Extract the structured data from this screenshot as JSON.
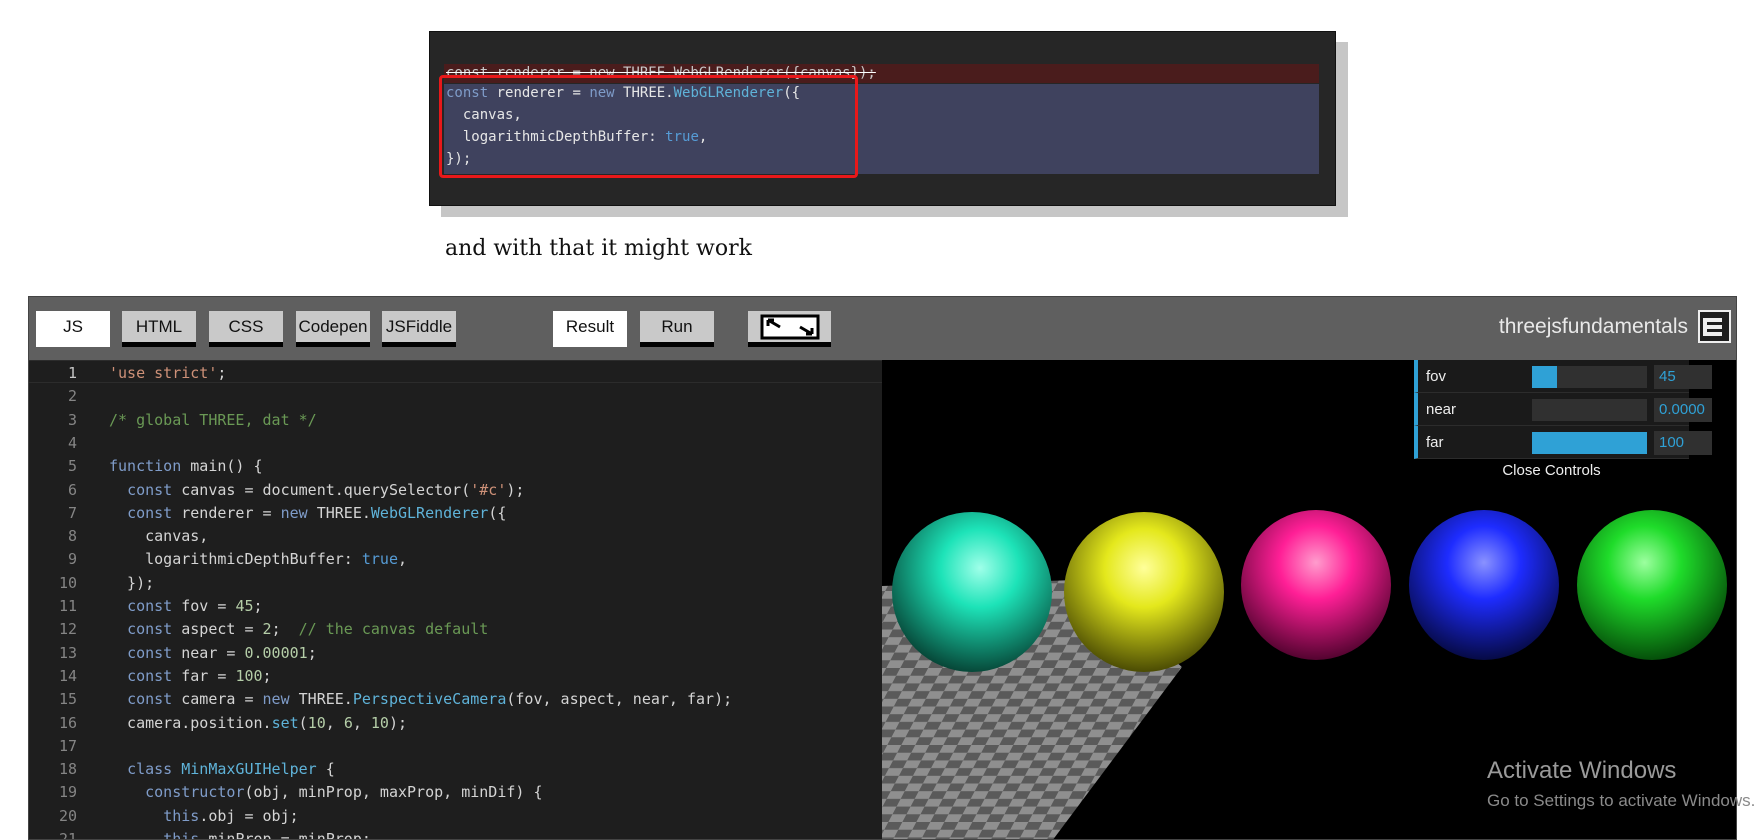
{
  "snippet": {
    "deleted_line": "const renderer = new THREE.WebGLRenderer({canvas});",
    "added_lines": [
      "const renderer = new THREE.WebGLRenderer({",
      "  canvas,",
      "  logarithmicDepthBuffer: true,",
      "});"
    ]
  },
  "caption": "and with that it might work",
  "toolbar": {
    "tabs": [
      "JS",
      "HTML",
      "CSS",
      "Codepen",
      "JSFiddle"
    ],
    "active_tab": "JS",
    "result_label": "Result",
    "run_label": "Run",
    "fullscreen_icon": "expand-arrows-icon",
    "brand": "threejsfundamentals",
    "brand_icon": "threejsfundamentals-logo-icon"
  },
  "editor": {
    "current_line": 1,
    "lines": [
      "'use strict';",
      "",
      "/* global THREE, dat */",
      "",
      "function main() {",
      "  const canvas = document.querySelector('#c');",
      "  const renderer = new THREE.WebGLRenderer({",
      "    canvas,",
      "    logarithmicDepthBuffer: true,",
      "  });",
      "  const fov = 45;",
      "  const aspect = 2;  // the canvas default",
      "  const near = 0.00001;",
      "  const far = 100;",
      "  const camera = new THREE.PerspectiveCamera(fov, aspect, near, far);",
      "  camera.position.set(10, 6, 10);",
      "",
      "  class MinMaxGUIHelper {",
      "    constructor(obj, minProp, maxProp, minDif) {",
      "      this.obj = obj;",
      "      this.minProp = minProp;"
    ]
  },
  "gui": {
    "controls": [
      {
        "label": "fov",
        "value": "45",
        "fill": 0.22
      },
      {
        "label": "near",
        "value": "0.0000",
        "fill": 0.0
      },
      {
        "label": "far",
        "value": "100",
        "fill": 1.0
      }
    ],
    "close_label": "Close Controls"
  },
  "scene": {
    "spheres": [
      "#1de3b8",
      "#e4e81c",
      "#ff1f96",
      "#1e2cff",
      "#1fdc2a"
    ]
  },
  "watermark": {
    "title": "Activate Windows",
    "subtitle": "Go to Settings to activate Windows."
  }
}
